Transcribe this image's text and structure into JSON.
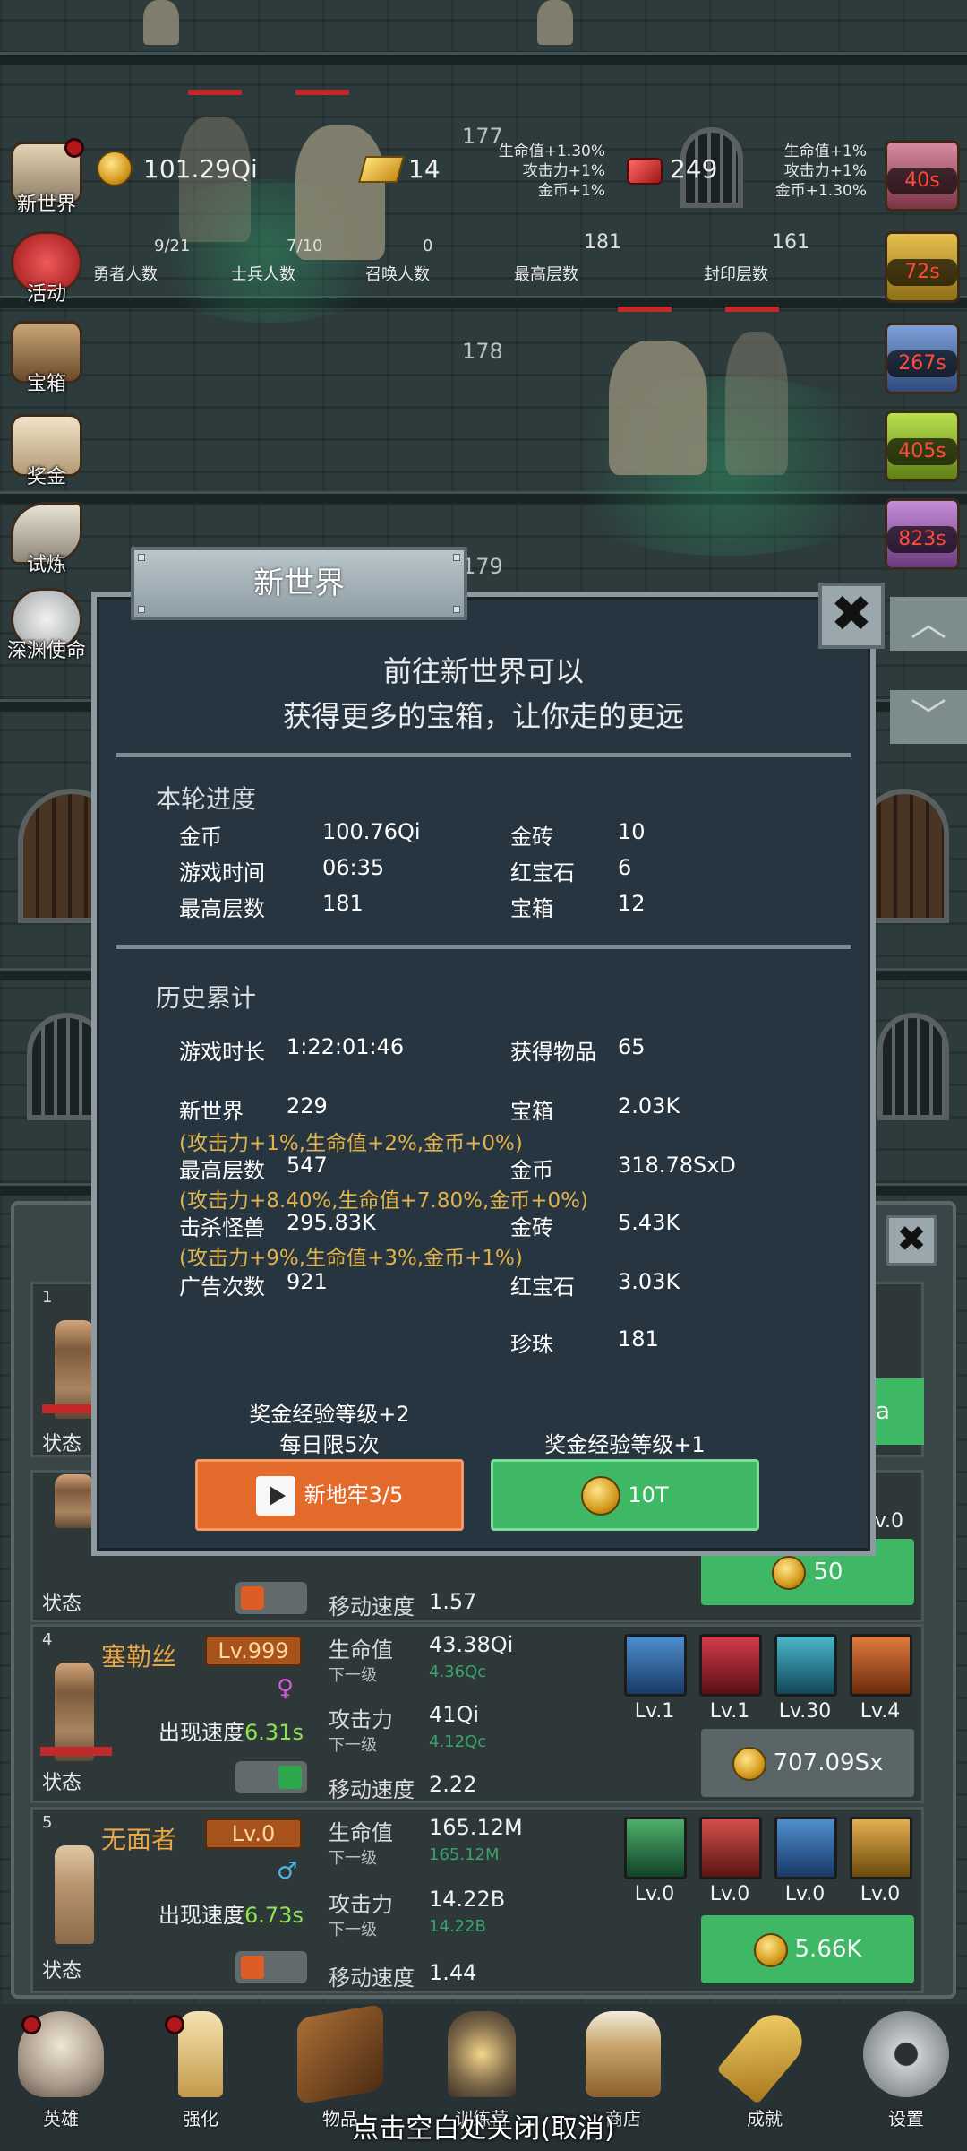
{
  "top_floors": [
    "177",
    "178",
    "179"
  ],
  "resources": {
    "gold": "101.29Qi",
    "gold_bar": "14",
    "ruby": "249",
    "bonus_left": [
      "生命值+1.30%",
      "攻击力+1%",
      "金币+1%"
    ],
    "bonus_right": [
      "生命值+1%",
      "攻击力+1%",
      "金币+1.30%"
    ]
  },
  "counters": [
    {
      "value": "9/21",
      "label": "勇者人数"
    },
    {
      "value": "7/10",
      "label": "士兵人数"
    },
    {
      "value": "0",
      "label": "召唤人数"
    },
    {
      "value": "181",
      "label": "最高层数"
    },
    {
      "value": "161",
      "label": "封印层数"
    }
  ],
  "left_menu": [
    "新世界",
    "活动",
    "宝箱",
    "奖金",
    "试炼",
    "深渊使命"
  ],
  "timers": [
    "40s",
    "72s",
    "267s",
    "405s",
    "823s"
  ],
  "arrows": {
    "up": "︿",
    "down": "﹀"
  },
  "dialog": {
    "title": "新世界",
    "close": "✖",
    "intro_line1": "前往新世界可以",
    "intro_line2": "获得更多的宝箱，让你走的更远",
    "round_title": "本轮进度",
    "round": [
      {
        "k": "金币",
        "v": "100.76Qi"
      },
      {
        "k": "游戏时间",
        "v": "06:35"
      },
      {
        "k": "最高层数",
        "v": "181"
      },
      {
        "k": "金砖",
        "v": "10"
      },
      {
        "k": "红宝石",
        "v": "6"
      },
      {
        "k": "宝箱",
        "v": "12"
      }
    ],
    "history_title": "历史累计",
    "history": {
      "play_time_k": "游戏时长",
      "play_time_v": "1:22:01:46",
      "items_k": "获得物品",
      "items_v": "65",
      "new_world_k": "新世界",
      "new_world_v": "229",
      "new_world_bonus": "(攻击力+1%,生命值+2%,金币+0%)",
      "chest_k": "宝箱",
      "chest_v": "2.03K",
      "max_floor_k": "最高层数",
      "max_floor_v": "547",
      "max_floor_bonus": "(攻击力+8.40%,生命值+7.80%,金币+0%)",
      "gold_k": "金币",
      "gold_v": "318.78SxD",
      "kills_k": "击杀怪兽",
      "kills_v": "295.83K",
      "kills_bonus": "(攻击力+9%,生命值+3%,金币+1%)",
      "goldbrick_k": "金砖",
      "goldbrick_v": "5.43K",
      "ads_k": "广告次数",
      "ads_v": "921",
      "ruby_k": "红宝石",
      "ruby_v": "3.03K",
      "pearl_k": "珍珠",
      "pearl_v": "181"
    },
    "left_btn_caption1": "奖金经验等级+2",
    "left_btn_caption2": "每日限5次",
    "right_btn_caption": "奖金经验等级+1",
    "left_btn": "新地牢3/5",
    "right_btn": "10T"
  },
  "heroes": [
    {
      "num": "1",
      "state": "状态"
    },
    {
      "num": "",
      "state": "状态",
      "move_k": "移动速度",
      "move_v": "1.57",
      "buy": "50"
    },
    {
      "num": "4",
      "name": "塞勒丝",
      "level": "Lv.999",
      "spawn_k": "出现速度",
      "spawn_v": "6.31s",
      "hp_k": "生命值",
      "hp_v": "43.38Qi",
      "next_k": "下一级",
      "hp_next": "4.36Qc",
      "atk_k": "攻击力",
      "atk_v": "41Qi",
      "atk_next": "4.12Qc",
      "move_k": "移动速度",
      "move_v": "2.22",
      "state": "状态",
      "skills": [
        "Lv.1",
        "Lv.1",
        "Lv.30",
        "Lv.4"
      ],
      "buy": "707.09Sx"
    },
    {
      "num": "5",
      "name": "无面者",
      "level": "Lv.0",
      "spawn_k": "出现速度",
      "spawn_v": "6.73s",
      "hp_k": "生命值",
      "hp_v": "165.12M",
      "next_k": "下一级",
      "hp_next": "165.12M",
      "atk_k": "攻击力",
      "atk_v": "14.22B",
      "atk_next": "14.22B",
      "move_k": "移动速度",
      "move_v": "1.44",
      "state": "状态",
      "skills": [
        "Lv.0",
        "Lv.0",
        "Lv.0",
        "Lv.0"
      ],
      "buy": "5.66K"
    }
  ],
  "partial_button": "a",
  "partial_lv": "v.0",
  "nav": [
    "英雄",
    "强化",
    "物品",
    "训练营",
    "商店",
    "成就",
    "设置"
  ],
  "close_hint": "点击空白处关闭(取消)"
}
